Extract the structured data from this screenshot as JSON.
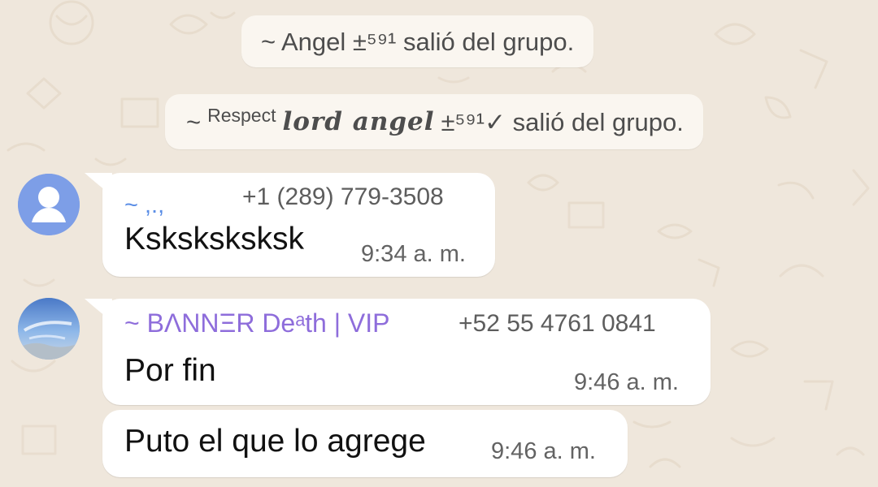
{
  "system_messages": [
    {
      "text": "~ Angel ±⁵⁹¹ salió del grupo."
    },
    {
      "prefix": "~",
      "respect": "Respect",
      "stylized_name": "lord angel",
      "suffix": "±⁵⁹¹✓ salió del grupo."
    }
  ],
  "messages": [
    {
      "sender_name": "~ ,.,",
      "phone": "+1 (289) 779-3508",
      "text": "Ksksksksksk",
      "time": "9:34 a. m."
    },
    {
      "sender_name": "~ BΛNNΞR Deᵃth | VIP",
      "phone": "+52 55 4761 0841",
      "text": "Por fin",
      "time": "9:46 a. m."
    },
    {
      "text": "Puto el que lo agrege",
      "time": "9:46 a. m."
    }
  ],
  "colors": {
    "wallpaper": "#efe7dc",
    "bubble": "#ffffff",
    "sender_1": "#5b8ee6",
    "sender_2": "#8e6ddb",
    "system_text": "#4d4d4d"
  },
  "icons": {
    "default_avatar": "person-silhouette-icon",
    "photo_avatar": "sky-photo-avatar"
  }
}
